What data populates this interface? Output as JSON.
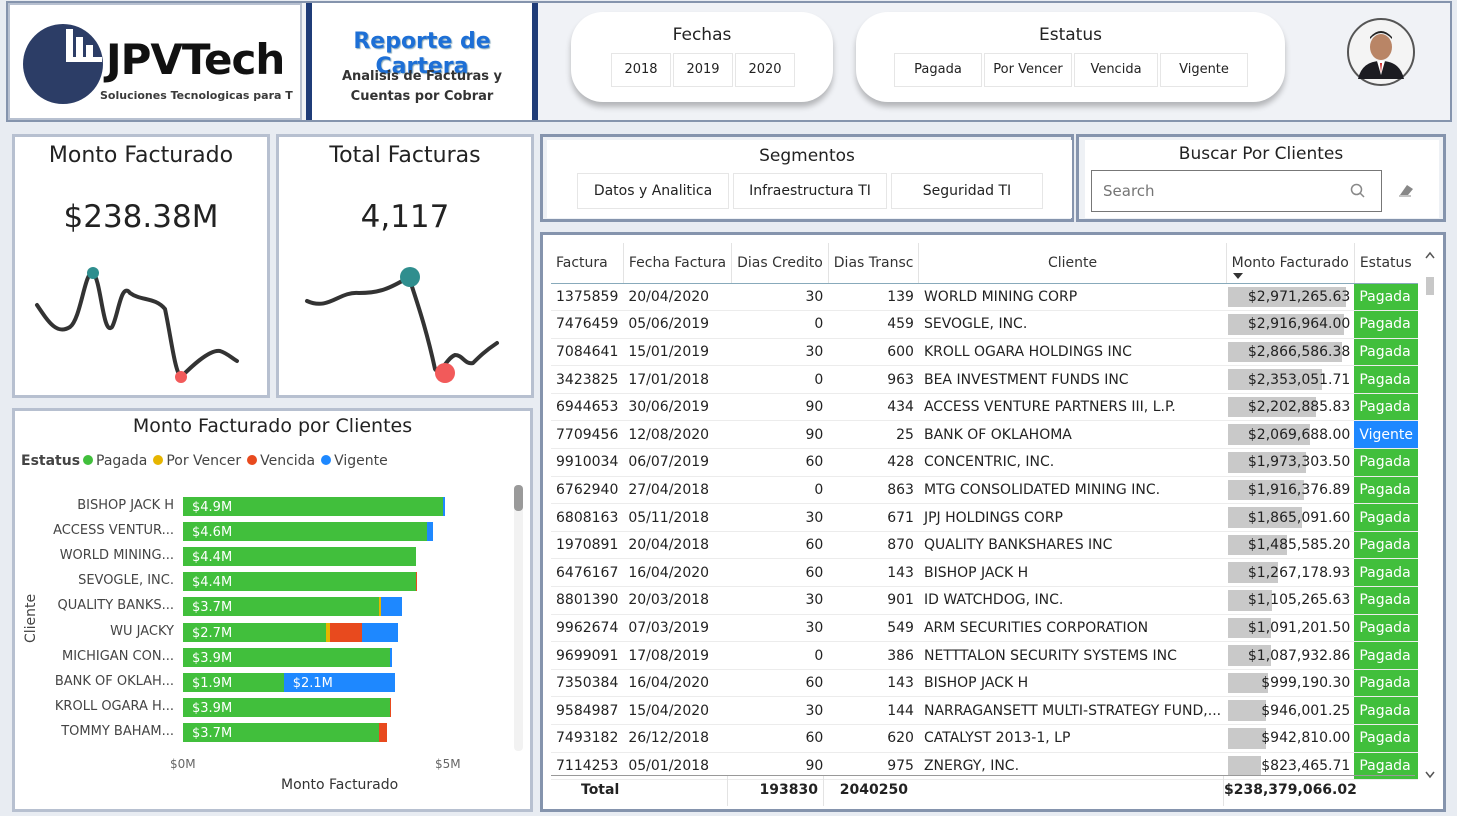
{
  "header": {
    "logo_name": "JPVTech",
    "logo_tagline": "Soluciones Tecnologicas para T",
    "report_title": "Reporte de Cartera",
    "report_subtitle_1": "Analisis de Facturas y",
    "report_subtitle_2": "Cuentas por Cobrar",
    "fechas": {
      "title": "Fechas",
      "options": [
        "2018",
        "2019",
        "2020"
      ]
    },
    "estatus": {
      "title": "Estatus",
      "options": [
        "Pagada",
        "Por Vencer",
        "Vencida",
        "Vigente"
      ]
    }
  },
  "kpis": {
    "monto": {
      "title": "Monto Facturado",
      "value": "$238.38M"
    },
    "total": {
      "title": "Total Facturas",
      "value": "4,117"
    }
  },
  "segmentos": {
    "title": "Segmentos",
    "options": [
      "Datos y Analitica",
      "Infraestructura TI",
      "Seguridad TI"
    ]
  },
  "buscar": {
    "title": "Buscar Por Clientes",
    "placeholder": "Search"
  },
  "colors": {
    "pagada": "#41bf3c",
    "por_vencer": "#e6b500",
    "vencida": "#e84a1e",
    "vigente": "#1e88ff",
    "accent": "#1f3c78"
  },
  "chart_data": {
    "type": "bar",
    "title": "Monto Facturado por Clientes",
    "legend_title": "Estatus",
    "xlabel": "Monto Facturado",
    "ylabel": "Cliente",
    "xticks": [
      "$0M",
      "$5M"
    ],
    "xlim": [
      0,
      5
    ],
    "categories": [
      "BISHOP JACK H",
      "ACCESS VENTUR...",
      "WORLD MINING...",
      "SEVOGLE, INC.",
      "QUALITY BANKS...",
      "WU JACKY",
      "MICHIGAN CON...",
      "BANK OF OKLAH...",
      "KROLL OGARA H...",
      "TOMMY BAHAM..."
    ],
    "series": [
      {
        "name": "Pagada",
        "values": [
          4.9,
          4.6,
          4.4,
          4.4,
          3.7,
          2.7,
          3.9,
          1.9,
          3.9,
          3.7
        ],
        "labels": [
          "$4.9M",
          "$4.6M",
          "$4.4M",
          "$4.4M",
          "$3.7M",
          "$2.7M",
          "$3.9M",
          "$1.9M",
          "$3.9M",
          "$3.7M"
        ]
      },
      {
        "name": "Por Vencer",
        "values": [
          0,
          0,
          0,
          0,
          0.03,
          0.08,
          0,
          0,
          0,
          0
        ],
        "labels": [
          "",
          "",
          "",
          "",
          "",
          "",
          "",
          "",
          "",
          ""
        ]
      },
      {
        "name": "Vencida",
        "values": [
          0,
          0,
          0,
          0.02,
          0,
          0.6,
          0,
          0,
          0.03,
          0.15
        ],
        "labels": [
          "",
          "",
          "",
          "",
          "",
          "",
          "",
          "",
          "",
          ""
        ]
      },
      {
        "name": "Vigente",
        "values": [
          0.05,
          0.12,
          0,
          0,
          0.4,
          0.67,
          0.05,
          2.1,
          0,
          0
        ],
        "labels": [
          "",
          "",
          "",
          "",
          "",
          "",
          "",
          "$2.1M",
          "",
          ""
        ]
      }
    ]
  },
  "table": {
    "columns": [
      "Factura",
      "Fecha Factura",
      "Dias Credito",
      "Dias Transc",
      "Cliente",
      "Monto Facturado",
      "Estatus"
    ],
    "rows": [
      [
        "1375859",
        "20/04/2020",
        "30",
        "139",
        "WORLD MINING CORP",
        "$2,971,265.63",
        "Pagada"
      ],
      [
        "7476459",
        "05/06/2019",
        "0",
        "459",
        "SEVOGLE, INC.",
        "$2,916,964.00",
        "Pagada"
      ],
      [
        "7084641",
        "15/01/2019",
        "30",
        "600",
        "KROLL OGARA HOLDINGS INC",
        "$2,866,586.38",
        "Pagada"
      ],
      [
        "3423825",
        "17/01/2018",
        "0",
        "963",
        "BEA INVESTMENT FUNDS INC",
        "$2,353,051.71",
        "Pagada"
      ],
      [
        "6944653",
        "30/06/2019",
        "90",
        "434",
        "ACCESS VENTURE PARTNERS III, L.P.",
        "$2,202,885.83",
        "Pagada"
      ],
      [
        "7709456",
        "12/08/2020",
        "90",
        "25",
        "BANK OF OKLAHOMA",
        "$2,069,688.00",
        "Vigente"
      ],
      [
        "9910034",
        "06/07/2019",
        "60",
        "428",
        "CONCENTRIC, INC.",
        "$1,973,303.50",
        "Pagada"
      ],
      [
        "6762940",
        "27/04/2018",
        "0",
        "863",
        "MTG CONSOLIDATED MINING INC.",
        "$1,916,376.89",
        "Pagada"
      ],
      [
        "6808163",
        "05/11/2018",
        "30",
        "671",
        "JPJ HOLDINGS CORP",
        "$1,865,091.60",
        "Pagada"
      ],
      [
        "1970891",
        "20/04/2018",
        "60",
        "870",
        "QUALITY BANKSHARES INC",
        "$1,485,585.20",
        "Pagada"
      ],
      [
        "6476167",
        "16/04/2020",
        "60",
        "143",
        "BISHOP JACK H",
        "$1,267,178.93",
        "Pagada"
      ],
      [
        "8801390",
        "20/03/2018",
        "30",
        "901",
        "ID WATCHDOG, INC.",
        "$1,105,265.63",
        "Pagada"
      ],
      [
        "9962674",
        "07/03/2019",
        "30",
        "549",
        "ARM SECURITIES CORPORATION",
        "$1,091,201.50",
        "Pagada"
      ],
      [
        "9699091",
        "17/08/2019",
        "0",
        "386",
        "NETTTALON SECURITY SYSTEMS INC",
        "$1,087,932.86",
        "Pagada"
      ],
      [
        "7350384",
        "16/04/2020",
        "60",
        "143",
        "BISHOP JACK H",
        "$999,190.30",
        "Pagada"
      ],
      [
        "9584987",
        "15/04/2020",
        "30",
        "144",
        "NARRAGANSETT MULTI-STRATEGY FUND,...",
        "$946,001.25",
        "Pagada"
      ],
      [
        "7493182",
        "26/12/2018",
        "60",
        "620",
        "CATALYST 2013-1, LP",
        "$942,810.00",
        "Pagada"
      ],
      [
        "7114253",
        "05/01/2018",
        "90",
        "975",
        "ZNERGY, INC.",
        "$823,465.71",
        "Pagada"
      ]
    ],
    "amounts": [
      2971265.63,
      2916964.0,
      2866586.38,
      2353051.71,
      2202885.83,
      2069688.0,
      1973303.5,
      1916376.89,
      1865091.6,
      1485585.2,
      1267178.93,
      1105265.63,
      1091201.5,
      1087932.86,
      999190.3,
      946001.25,
      942810.0,
      823465.71
    ],
    "total": {
      "label": "Total",
      "dias_credito": "193830",
      "dias_transc": "2040250",
      "monto": "$238,379,066.02"
    }
  }
}
